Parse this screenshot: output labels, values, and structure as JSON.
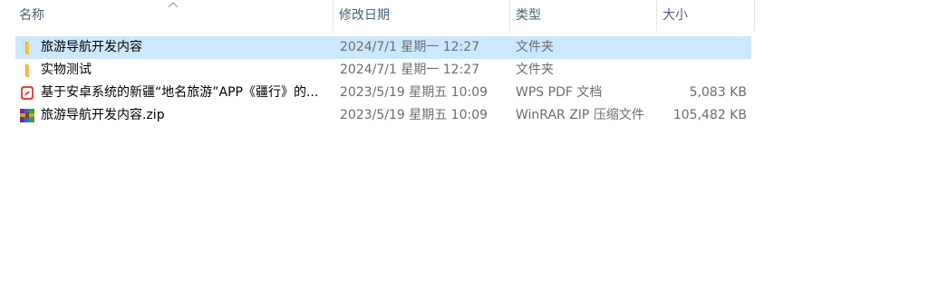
{
  "columns": {
    "name": "名称",
    "date": "修改日期",
    "type": "类型",
    "size": "大小"
  },
  "sort_indicator": "ascending",
  "files": [
    {
      "name": "旅游导航开发内容",
      "date": "2024/7/1 星期一 12:27",
      "type": "文件夹",
      "size": "",
      "icon": "folder-icon",
      "selected": true
    },
    {
      "name": "实物测试",
      "date": "2024/7/1 星期一 12:27",
      "type": "文件夹",
      "size": "",
      "icon": "folder-icon",
      "selected": false
    },
    {
      "name": "基于安卓系统的新疆“地名旅游”APP《疆行》的...",
      "date": "2023/5/19 星期五 10:09",
      "type": "WPS PDF 文档",
      "size": "5,083 KB",
      "icon": "pdf-icon",
      "selected": false
    },
    {
      "name": "旅游导航开发内容.zip",
      "date": "2023/5/19 星期五 10:09",
      "type": "WinRAR ZIP 压缩文件",
      "size": "105,482 KB",
      "icon": "winrar-zip-icon",
      "selected": false
    }
  ],
  "colors": {
    "selected_row": "#cce8ff",
    "header_text": "#4c607a",
    "secondary_text": "#6d6d6d",
    "folder": "#f4c14d",
    "pdf": "#e4453a"
  }
}
